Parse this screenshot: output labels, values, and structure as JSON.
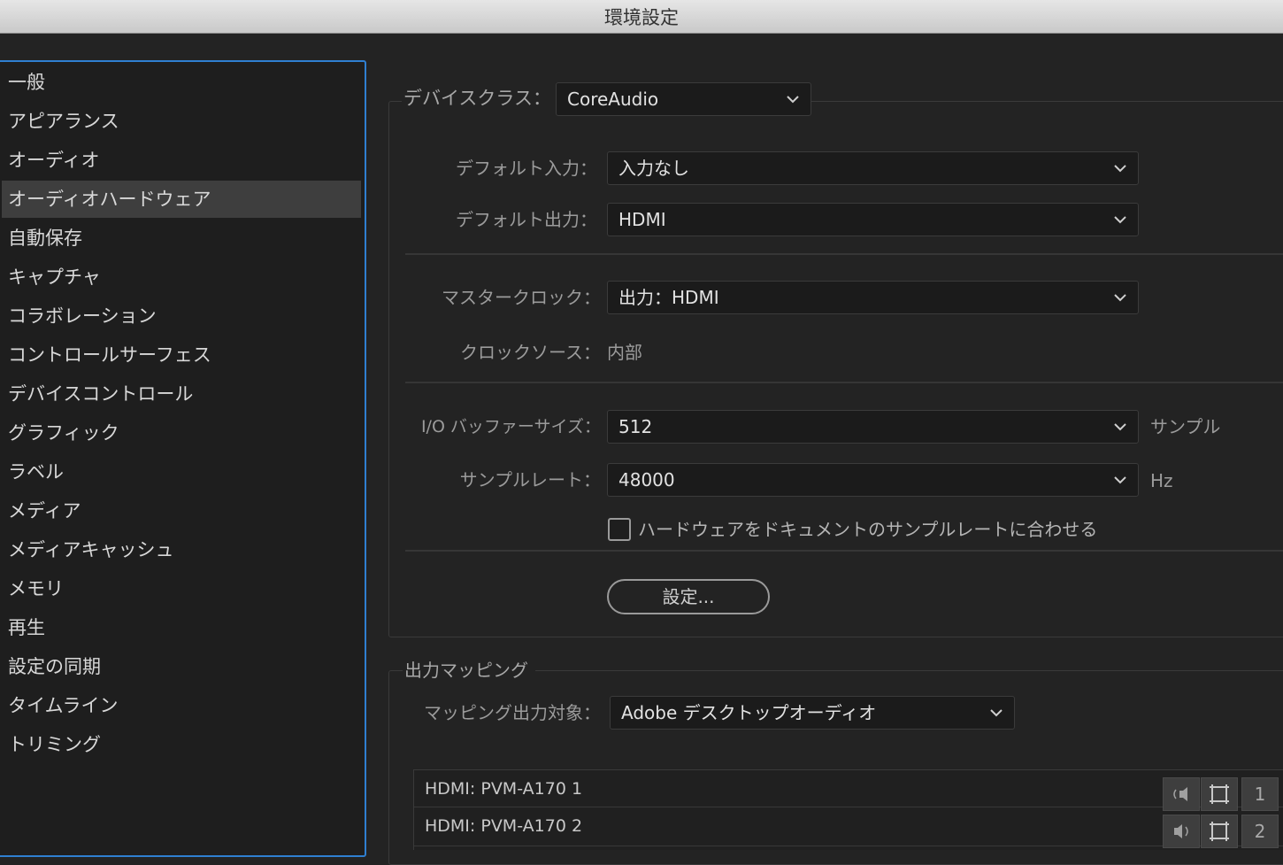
{
  "window": {
    "title": "環境設定"
  },
  "sidebar": {
    "selected_index": 3,
    "items": [
      {
        "label": "一般"
      },
      {
        "label": "アピアランス"
      },
      {
        "label": "オーディオ"
      },
      {
        "label": "オーディオハードウェア"
      },
      {
        "label": "自動保存"
      },
      {
        "label": "キャプチャ"
      },
      {
        "label": "コラボレーション"
      },
      {
        "label": "コントロールサーフェス"
      },
      {
        "label": "デバイスコントロール"
      },
      {
        "label": "グラフィック"
      },
      {
        "label": "ラベル"
      },
      {
        "label": "メディア"
      },
      {
        "label": "メディアキャッシュ"
      },
      {
        "label": "メモリ"
      },
      {
        "label": "再生"
      },
      {
        "label": "設定の同期"
      },
      {
        "label": "タイムライン"
      },
      {
        "label": "トリミング"
      }
    ]
  },
  "device": {
    "class_label": "デバイスクラス：",
    "class_value": "CoreAudio",
    "default_input_label": "デフォルト入力：",
    "default_input_value": "入力なし",
    "default_output_label": "デフォルト出力：",
    "default_output_value": "HDMI",
    "master_clock_label": "マスタークロック：",
    "master_clock_value": "出力：HDMI",
    "clock_source_label": "クロックソース：",
    "clock_source_value": "内部",
    "buffer_label": "I/O バッファーサイズ：",
    "buffer_value": "512",
    "buffer_unit": "サンプル",
    "sample_rate_label": "サンプルレート：",
    "sample_rate_value": "48000",
    "sample_rate_unit": "Hz",
    "match_checkbox_label": "ハードウェアをドキュメントのサンプルレートに合わせる",
    "match_checkbox_checked": false,
    "settings_button": "設定..."
  },
  "output_mapping": {
    "legend": "出力マッピング",
    "target_label": "マッピング出力対象：",
    "target_value": "Adobe デスクトップオーディオ",
    "rows": [
      {
        "name": "HDMI: PVM-A170 1",
        "channel": "1"
      },
      {
        "name": "HDMI: PVM-A170 2",
        "channel": "2"
      }
    ]
  },
  "icons": {
    "dropdown": "chevron-down-icon",
    "speaker_left": "speaker-left-icon",
    "speaker_right": "speaker-right-icon",
    "frame": "frame-icon"
  },
  "colors": {
    "accent": "#2f7fd1",
    "background": "#232323",
    "sidebar_selected": "#3e3e3e"
  }
}
